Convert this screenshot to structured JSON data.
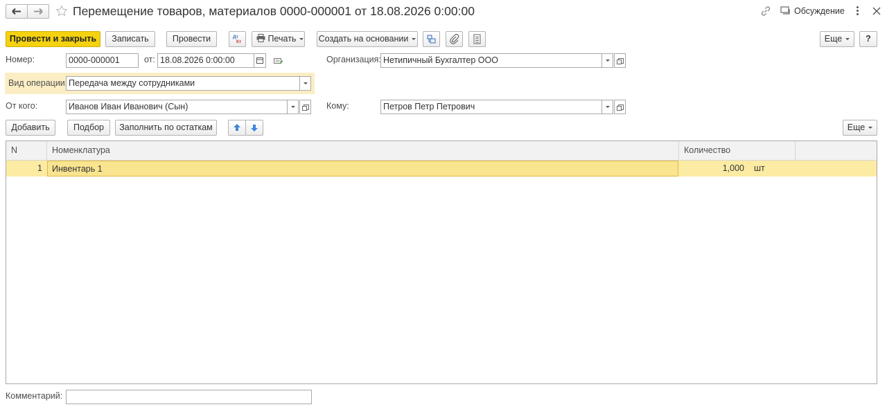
{
  "title": "Перемещение товаров, материалов 0000-000001 от 18.08.2026 0:00:00",
  "header": {
    "discussion_label": "Обсуждение"
  },
  "toolbar": {
    "post_and_close": "Провести и закрыть",
    "save": "Записать",
    "post": "Провести",
    "dtkt_icon": "Дт Кт",
    "print": "Печать",
    "create_based_on": "Создать на основании",
    "more": "Еще",
    "help": "?"
  },
  "form": {
    "number_label": "Номер:",
    "number_value": "0000-000001",
    "date_label": "от:",
    "date_value": "18.08.2026  0:00:00",
    "org_label": "Организация:",
    "org_value": "Нетипичный Бухгалтер ООО",
    "op_label": "Вид операции:",
    "op_value": "Передача между сотрудниками",
    "from_label": "От кого:",
    "from_value": "Иванов Иван Иванович (Сын)",
    "to_label": "Кому:",
    "to_value": "Петров Петр Петрович",
    "comment_label": "Комментарий:",
    "comment_value": ""
  },
  "table_toolbar": {
    "add": "Добавить",
    "pick": "Подбор",
    "fill": "Заполнить по остаткам",
    "more": "Еще"
  },
  "table": {
    "columns": [
      "N",
      "Номенклатура",
      "Количество"
    ],
    "rows": [
      {
        "n": "1",
        "item": "Инвентарь 1",
        "qty": "1,000",
        "unit": "шт"
      }
    ]
  },
  "colors": {
    "accent": "#f5d20f",
    "selected_row": "#fbeba3",
    "highlight": "#fbeec4"
  }
}
